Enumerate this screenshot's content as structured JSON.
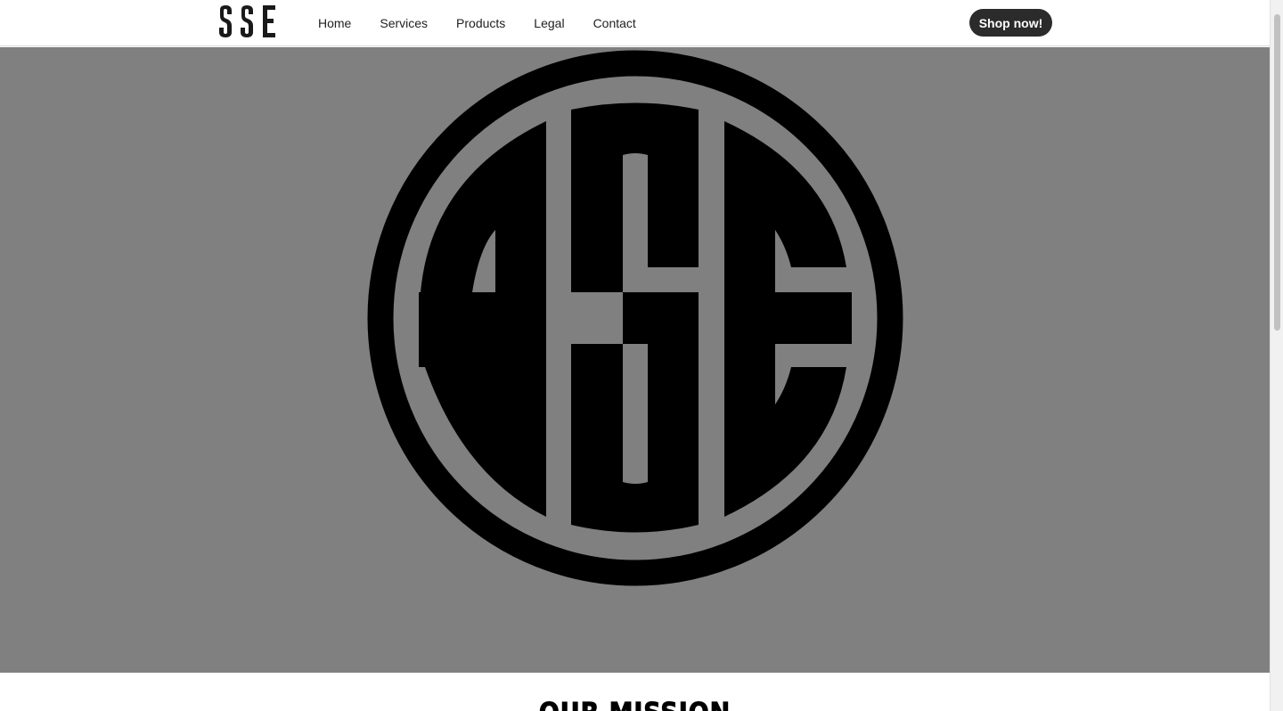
{
  "header": {
    "logo_text": "SSE",
    "nav": [
      {
        "label": "Home"
      },
      {
        "label": "Services"
      },
      {
        "label": "Products"
      },
      {
        "label": "Legal"
      },
      {
        "label": "Contact"
      }
    ],
    "cta_label": "Shop now!"
  },
  "hero": {
    "emblem_text": "SSE",
    "background_color": "#808080",
    "emblem_color": "#000000"
  },
  "mission": {
    "title": "OUR MISSION"
  }
}
